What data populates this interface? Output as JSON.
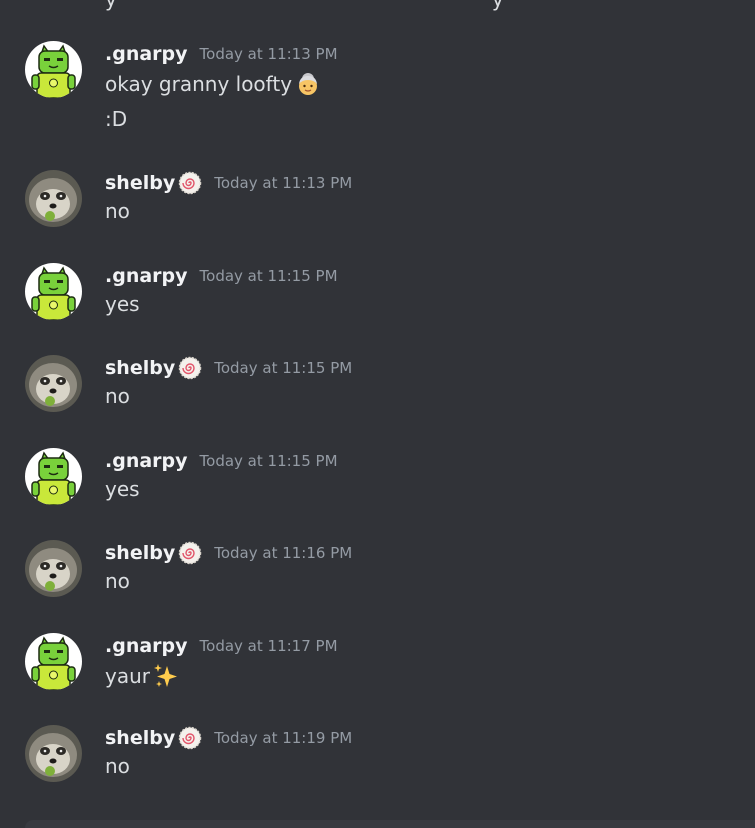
{
  "messages": [
    {
      "username": ".gnarpy",
      "timestamp": "Today at 11:13 PM",
      "lines": [
        "okay granny loofty",
        ":D"
      ],
      "avatar": "green-cat-icon",
      "emoji": "older-woman-emoji"
    },
    {
      "username": "shelby",
      "badge": "narutomaki-icon",
      "timestamp": "Today at 11:13 PM",
      "lines": [
        "no"
      ],
      "avatar": "raccoon-photo"
    },
    {
      "username": ".gnarpy",
      "timestamp": "Today at 11:15 PM",
      "lines": [
        "yes"
      ],
      "avatar": "green-cat-icon"
    },
    {
      "username": "shelby",
      "badge": "narutomaki-icon",
      "timestamp": "Today at 11:15 PM",
      "lines": [
        "no"
      ],
      "avatar": "raccoon-photo"
    },
    {
      "username": ".gnarpy",
      "timestamp": "Today at 11:15 PM",
      "lines": [
        "yes"
      ],
      "avatar": "green-cat-icon"
    },
    {
      "username": "shelby",
      "badge": "narutomaki-icon",
      "timestamp": "Today at 11:16 PM",
      "lines": [
        "no"
      ],
      "avatar": "raccoon-photo"
    },
    {
      "username": ".gnarpy",
      "timestamp": "Today at 11:17 PM",
      "lines": [
        "yaur"
      ],
      "avatar": "green-cat-icon",
      "emoji": "sparkles-emoji"
    },
    {
      "username": "shelby",
      "badge": "narutomaki-icon",
      "timestamp": "Today at 11:19 PM",
      "lines": [
        "no"
      ],
      "avatar": "raccoon-photo"
    }
  ],
  "colors": {
    "background": "#313338",
    "username": "#f2f3f5",
    "message_text": "#dbdee1",
    "timestamp": "#949ba4",
    "input_bar": "#383a40"
  }
}
